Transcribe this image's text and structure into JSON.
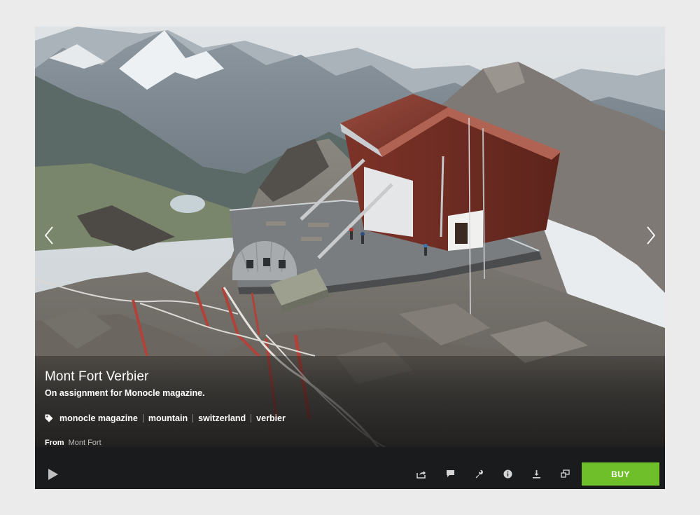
{
  "photo": {
    "alt": "Mont Fort Verbier mountain hut on a rocky ridge",
    "prev_icon": "chevron-left-icon",
    "next_icon": "chevron-right-icon"
  },
  "caption": {
    "title": "Mont Fort Verbier",
    "description": "On assignment for Monocle magazine.",
    "tag_icon": "tag-icon",
    "tags": [
      "monocle magazine",
      "mountain",
      "switzerland",
      "verbier"
    ],
    "from_label": "From",
    "from_link": "Mont Fort"
  },
  "toolbar": {
    "play_icon": "play-icon",
    "tools": [
      "share-icon",
      "comment-icon",
      "wrench-icon",
      "info-icon",
      "download-icon",
      "resize-icon"
    ],
    "buy_label": "BUY",
    "buy_color": "#6fbf2a"
  }
}
